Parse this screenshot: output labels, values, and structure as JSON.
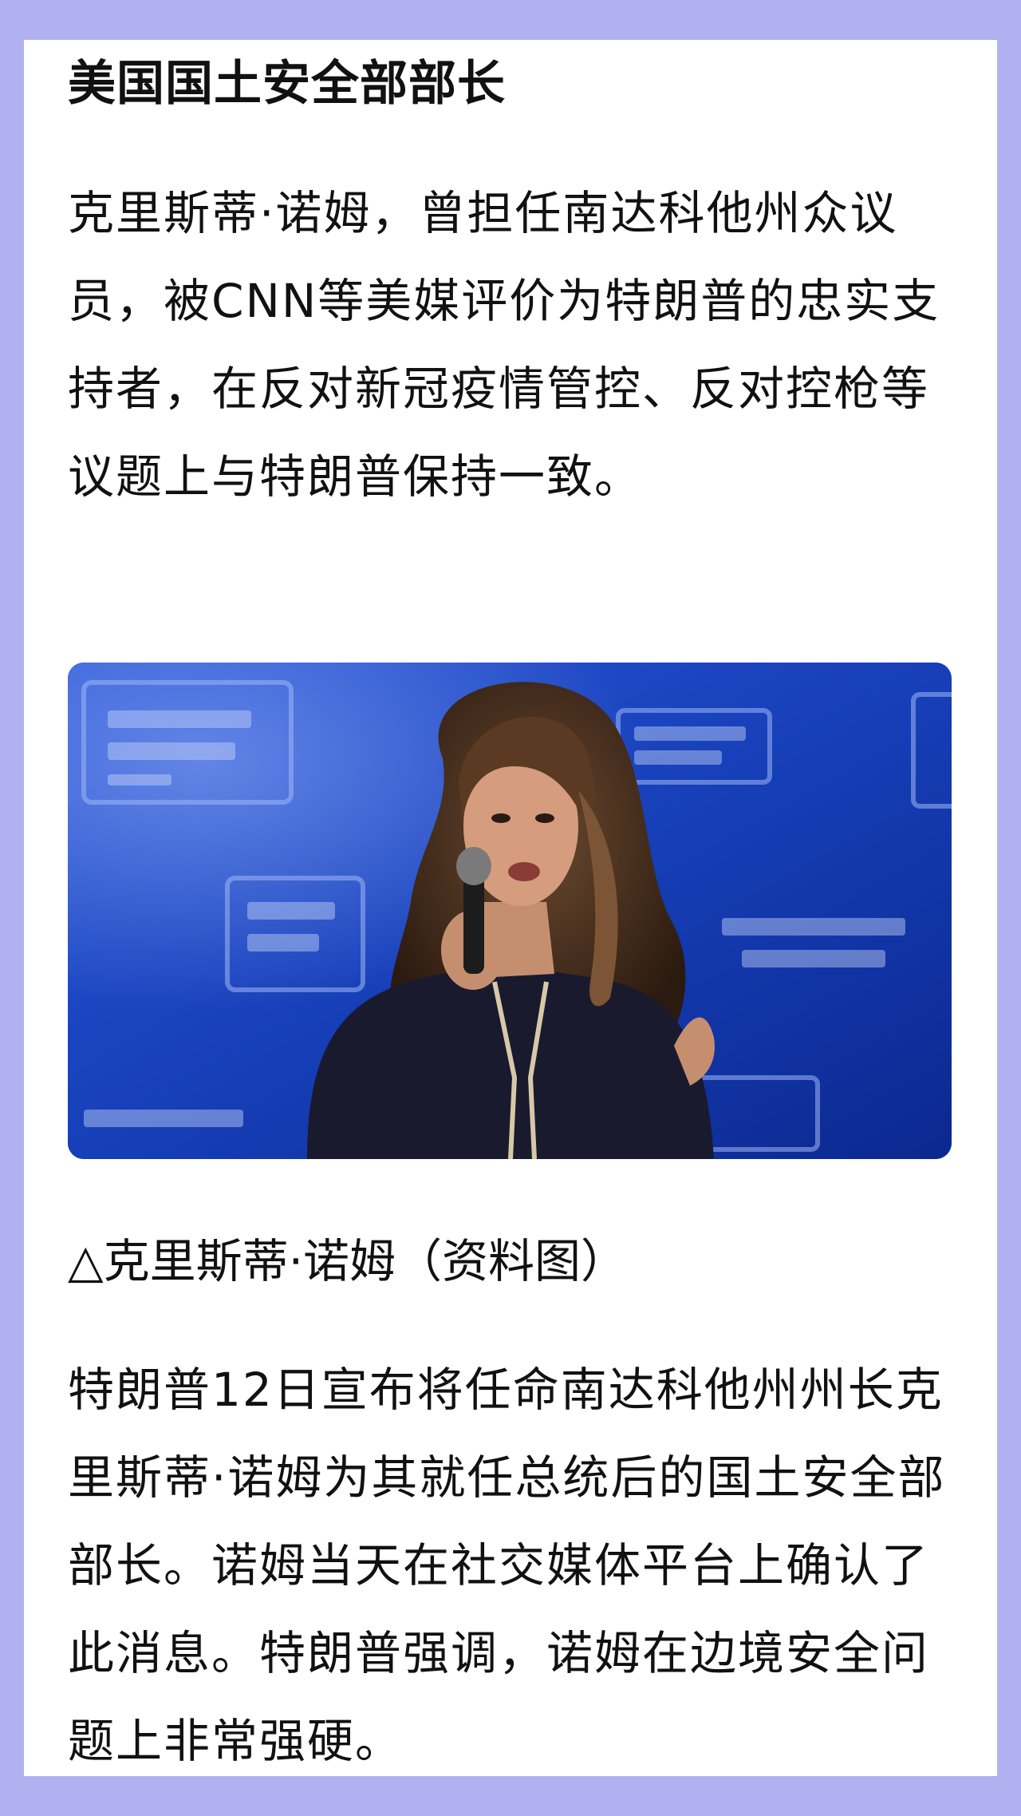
{
  "article": {
    "heading": "美国国土安全部部长",
    "paragraph1": "克里斯蒂·诺姆，曾担任南达科他州众议员，被CNN等美媒评价为特朗普的忠实支持者，在反对新冠疫情管控、反对控枪等议题上与特朗普保持一致。",
    "image": {
      "caption": "△克里斯蒂·诺姆（资料图）",
      "backdrop_colors": [
        "#0f2f9e",
        "#2b55d6",
        "#6e8fe8"
      ]
    },
    "paragraph2": "特朗普12日宣布将任命南达科他州州长克里斯蒂·诺姆为其就任总统后的国土安全部部长。诺姆当天在社交媒体平台上确认了此消息。特朗普强调，诺姆在边境安全问题上非常强硬。"
  },
  "colors": {
    "page_background": "#b1b1f1",
    "card_background": "#ffffff",
    "text": "#111111"
  }
}
